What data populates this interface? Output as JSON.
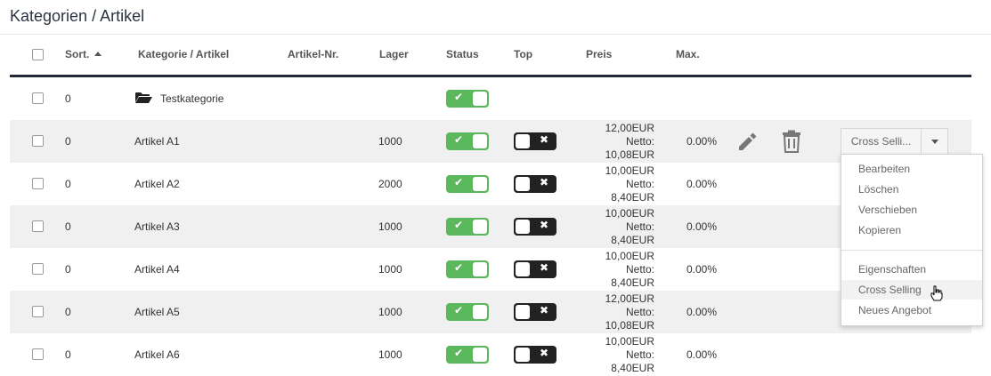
{
  "page": {
    "title": "Kategorien / Artikel"
  },
  "table": {
    "headers": {
      "sort": "Sort.",
      "name": "Kategorie / Artikel",
      "article_no": "Artikel-Nr.",
      "stock": "Lager",
      "status": "Status",
      "top": "Top",
      "price": "Preis",
      "max": "Max."
    },
    "category_row": {
      "sort": "0",
      "name": "Testkategorie",
      "status_on": true
    },
    "rows": [
      {
        "sort": "0",
        "name": "Artikel A1",
        "stock": "1000",
        "price_gross": "12,00EUR",
        "net_label": "Netto:",
        "price_net": "10,08EUR",
        "max": "0.00%",
        "status_on": true,
        "top_on": false
      },
      {
        "sort": "0",
        "name": "Artikel A2",
        "stock": "2000",
        "price_gross": "10,00EUR",
        "net_label": "Netto:",
        "price_net": "8,40EUR",
        "max": "0.00%",
        "status_on": true,
        "top_on": false
      },
      {
        "sort": "0",
        "name": "Artikel A3",
        "stock": "1000",
        "price_gross": "10,00EUR",
        "net_label": "Netto:",
        "price_net": "8,40EUR",
        "max": "0.00%",
        "status_on": true,
        "top_on": false
      },
      {
        "sort": "0",
        "name": "Artikel A4",
        "stock": "1000",
        "price_gross": "10,00EUR",
        "net_label": "Netto:",
        "price_net": "8,40EUR",
        "max": "0.00%",
        "status_on": true,
        "top_on": false
      },
      {
        "sort": "0",
        "name": "Artikel A5",
        "stock": "1000",
        "price_gross": "12,00EUR",
        "net_label": "Netto:",
        "price_net": "10,08EUR",
        "max": "0.00%",
        "status_on": true,
        "top_on": false
      },
      {
        "sort": "0",
        "name": "Artikel A6",
        "stock": "1000",
        "price_gross": "10,00EUR",
        "net_label": "Netto:",
        "price_net": "8,40EUR",
        "max": "0.00%",
        "status_on": true,
        "top_on": false
      }
    ]
  },
  "actions": {
    "split_button_label": "Cross Selli...",
    "edit_icon": "pencil-icon",
    "delete_icon": "trash-icon"
  },
  "dropdown": {
    "group1": [
      "Bearbeiten",
      "Löschen",
      "Verschieben",
      "Kopieren"
    ],
    "group2": [
      "Eigenschaften",
      "Cross Selling",
      "Neues Angebot"
    ],
    "hover_item": "Cross Selling"
  },
  "colors": {
    "toggle_on": "#5cb85c",
    "toggle_off": "#222222",
    "header_rule": "#1f2a36",
    "row_alt": "#f0f0f0"
  }
}
